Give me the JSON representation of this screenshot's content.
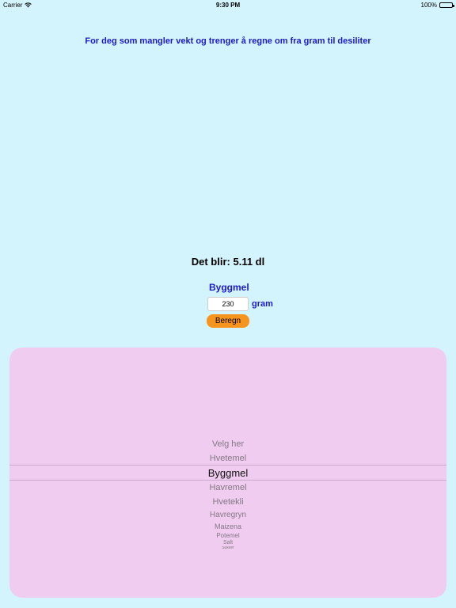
{
  "status_bar": {
    "carrier": "Carrier",
    "time": "9:30 PM",
    "battery": "100%"
  },
  "headline": "For deg som mangler vekt og trenger å regne om fra gram til desiliter",
  "result_text": "Det blir: 5.11 dl",
  "selected_ingredient": "Byggmel",
  "gram_input": {
    "value": "230",
    "unit_label": "gram"
  },
  "calculate_button": "Beregn",
  "picker": {
    "items": [
      "Velg her",
      "Hvetemel",
      "Byggmel",
      "Havremel",
      "Hvetekli",
      "Havregryn",
      "Maizena",
      "Potemel",
      "Salt",
      "Sukker"
    ],
    "selected_index": 2
  },
  "colors": {
    "background": "#d4f4fd",
    "accent_text": "#1a1acc",
    "button": "#f7941d",
    "picker_panel": "#f0cdf0"
  },
  "icons": [
    "wifi-icon",
    "battery-icon"
  ]
}
